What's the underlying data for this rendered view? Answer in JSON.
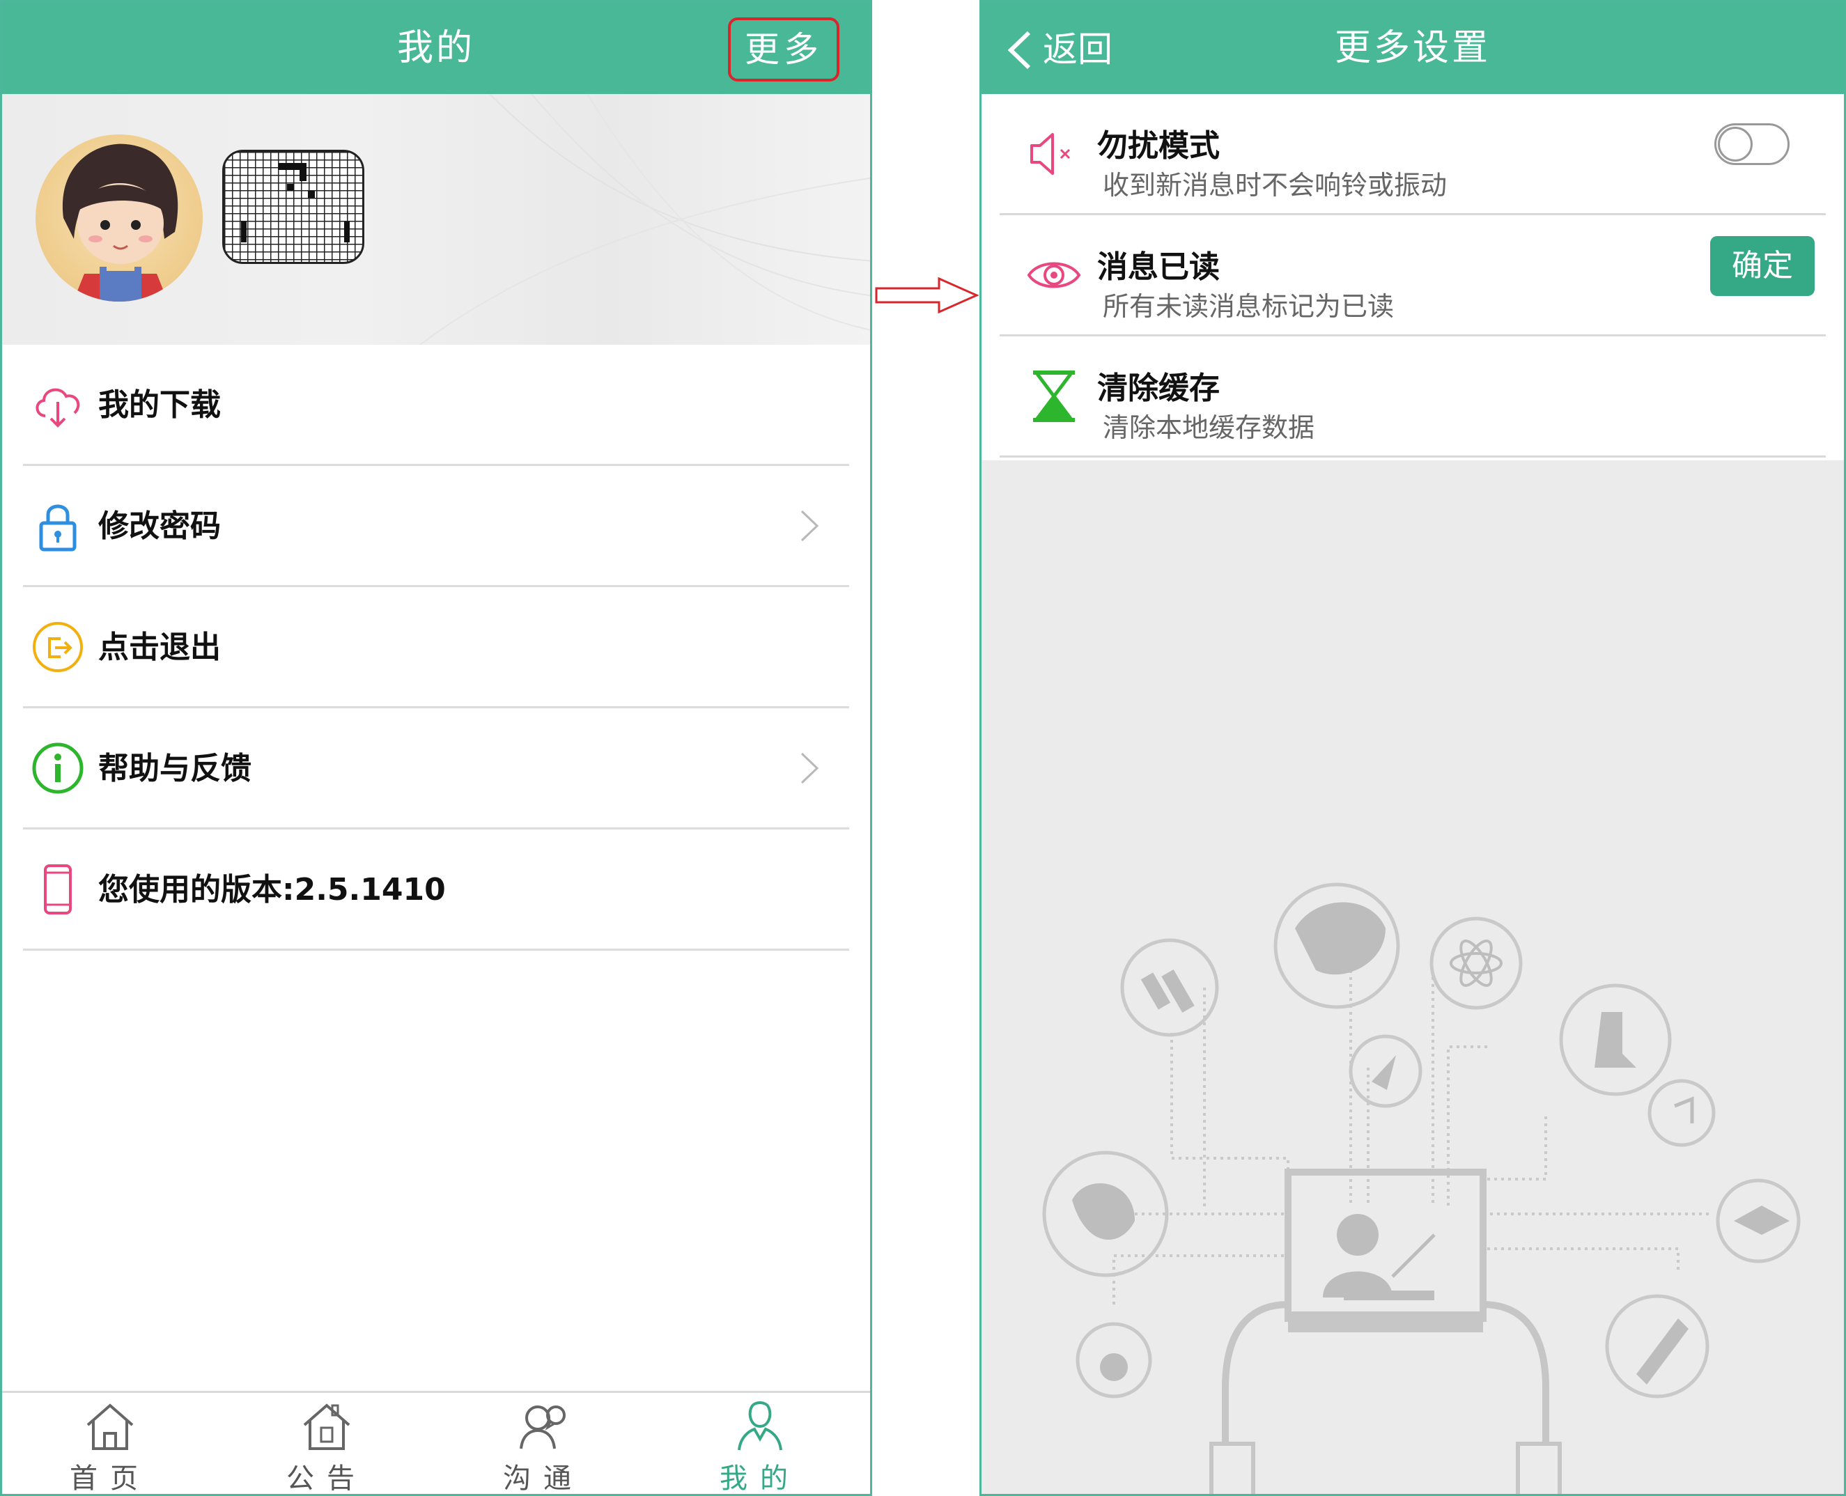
{
  "left_screen": {
    "header": {
      "title": "我的",
      "more_label": "更多"
    },
    "menu": [
      {
        "icon": "cloud-download-icon",
        "label": "我的下载",
        "chevron": false,
        "color": "#e8477f"
      },
      {
        "icon": "lock-icon",
        "label": "修改密码",
        "chevron": true,
        "color": "#2e8fe0"
      },
      {
        "icon": "logout-icon",
        "label": "点击退出",
        "chevron": false,
        "color": "#f2b010"
      },
      {
        "icon": "info-icon",
        "label": "帮助与反馈",
        "chevron": true,
        "color": "#2db52d"
      },
      {
        "icon": "phone-icon",
        "label": "您使用的版本:2.5.1410",
        "chevron": false,
        "color": "#e8477f"
      }
    ],
    "tabs": [
      {
        "icon": "home-icon",
        "label": "首页",
        "active": false
      },
      {
        "icon": "announcement-icon",
        "label": "公告",
        "active": false
      },
      {
        "icon": "chat-icon",
        "label": "沟通",
        "active": false
      },
      {
        "icon": "person-icon",
        "label": "我的",
        "active": true
      }
    ]
  },
  "right_screen": {
    "header": {
      "title": "更多设置",
      "back_label": "返回"
    },
    "settings": [
      {
        "icon": "mute-icon",
        "name": "勿扰模式",
        "desc": "收到新消息时不会响铃或振动",
        "control": "toggle",
        "toggle_on": false
      },
      {
        "icon": "eye-icon",
        "name": "消息已读",
        "desc": "所有未读消息标记为已读",
        "control": "button",
        "button_label": "确定"
      },
      {
        "icon": "hourglass-icon",
        "name": "清除缓存",
        "desc": "清除本地缓存数据",
        "control": "none"
      }
    ]
  },
  "colors": {
    "header_green": "#48b896",
    "accent_green": "#35a886",
    "highlight_red": "#d8262b"
  }
}
